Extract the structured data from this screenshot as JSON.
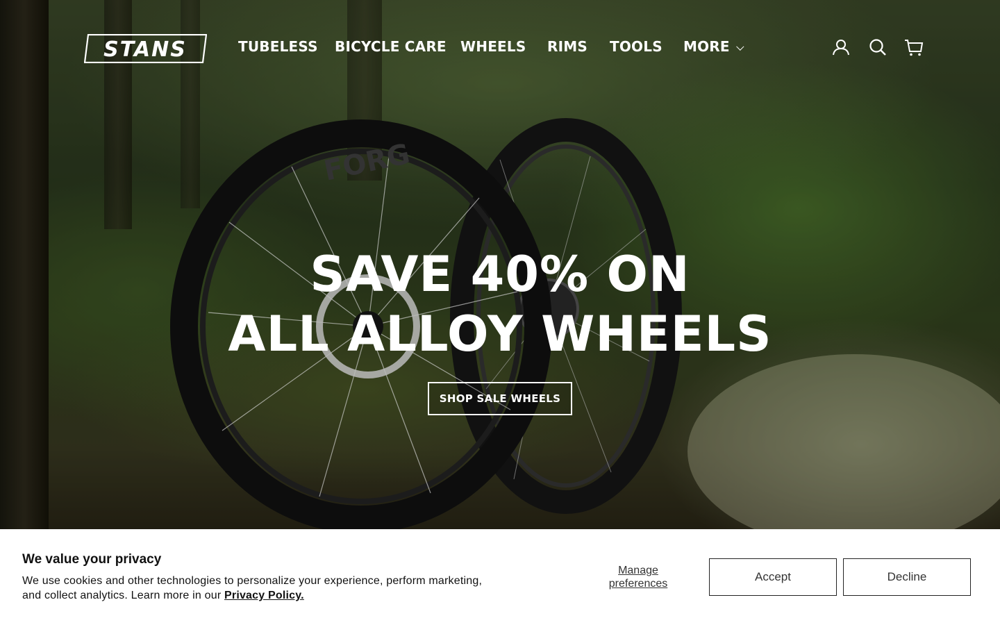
{
  "brand": {
    "logo_text": "STANS"
  },
  "nav": {
    "items": [
      {
        "label": "TUBELESS"
      },
      {
        "label": "BICYCLE CARE"
      },
      {
        "label": "WHEELS"
      },
      {
        "label": "RIMS"
      },
      {
        "label": "TOOLS"
      },
      {
        "label": "MORE"
      }
    ]
  },
  "header_icons": [
    "account-icon",
    "search-icon",
    "cart-icon"
  ],
  "hero": {
    "headline_line1": "SAVE 40% ON",
    "headline_line2": "ALL ALLOY WHEELS",
    "cta_label": "SHOP SALE WHEELS",
    "tire_text": "FORG"
  },
  "cookie_banner": {
    "title": "We value your privacy",
    "body": "We use cookies and other technologies to personalize your experience, perform marketing, and collect analytics. Learn more in our ",
    "policy_link": "Privacy Policy.",
    "manage_line1": "Manage",
    "manage_line2": "preferences",
    "accept_label": "Accept",
    "decline_label": "Decline"
  },
  "colors": {
    "text_on_hero": "#ffffff",
    "banner_bg": "#ffffff",
    "button_border": "#222222"
  }
}
